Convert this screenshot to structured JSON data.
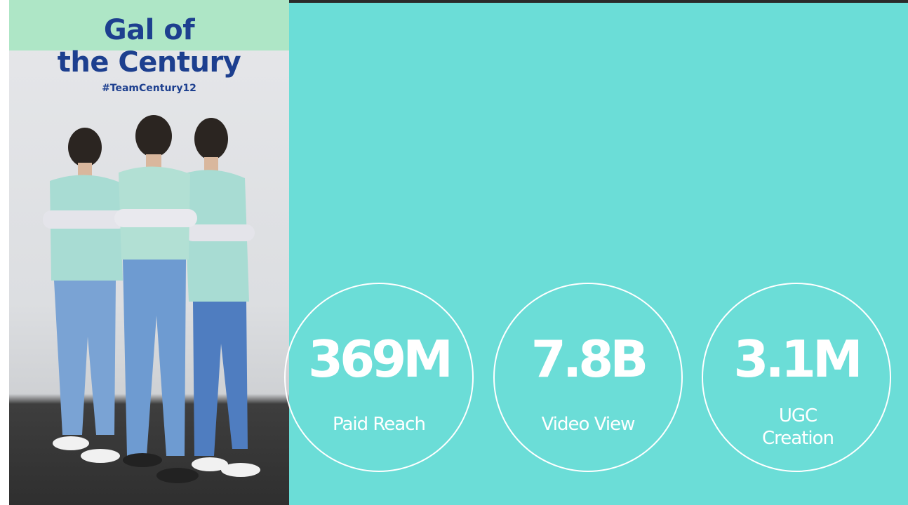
{
  "poster": {
    "title_line1": "Gal of",
    "title_line2": "the Century",
    "hashtag": "#TeamCentury12"
  },
  "stats": [
    {
      "value": "369M",
      "label": "Paid Reach"
    },
    {
      "value": "7.8B",
      "label": "Video View"
    },
    {
      "value": "3.1M",
      "label": "UGC Creation"
    }
  ],
  "colors": {
    "background": "#6bddd7",
    "accent_text": "#ffffff",
    "poster_band": "#aee6c6",
    "poster_title": "#1d3f8f"
  }
}
